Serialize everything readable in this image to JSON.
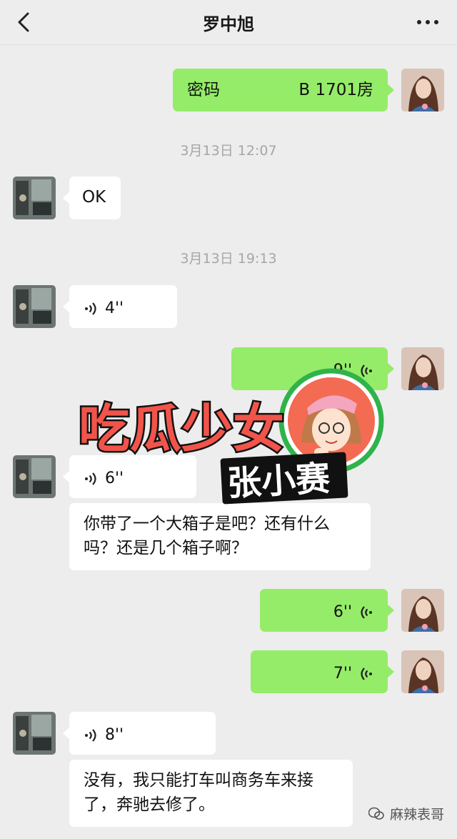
{
  "header": {
    "title": "罗中旭",
    "back_icon": "chevron-left-icon",
    "more_icon": "ellipsis-icon"
  },
  "messages": {
    "m1": {
      "sender": "me",
      "label": "密码",
      "value": "B 1701房"
    },
    "t1": "3月13日 12:07",
    "m2": {
      "sender": "contact",
      "text": "OK"
    },
    "t2": "3月13日 19:13",
    "m3": {
      "sender": "contact",
      "voice": "4''"
    },
    "m4": {
      "sender": "me",
      "voice": "9''"
    },
    "m5": {
      "sender": "contact",
      "voice": "6''"
    },
    "m6": {
      "sender": "contact",
      "text": "你带了一个大箱子是吧？还有什么吗？还是几个箱子啊？"
    },
    "m7": {
      "sender": "me",
      "voice": "6''"
    },
    "m8": {
      "sender": "me",
      "voice": "7''"
    },
    "m9": {
      "sender": "contact",
      "voice": "8''"
    },
    "m10": {
      "sender": "contact",
      "text": "没有，我只能打车叫商务车来接了，奔驰去修了。"
    }
  },
  "sticker": {
    "line1": "吃瓜少女",
    "line2": "张小赛"
  },
  "watermark": {
    "text": "麻辣表哥",
    "icon": "wechat-official-account-icon"
  },
  "colors": {
    "background": "#ededed",
    "my_bubble": "#95ec69",
    "their_bubble": "#ffffff",
    "timestamp": "#a6a6a6"
  }
}
